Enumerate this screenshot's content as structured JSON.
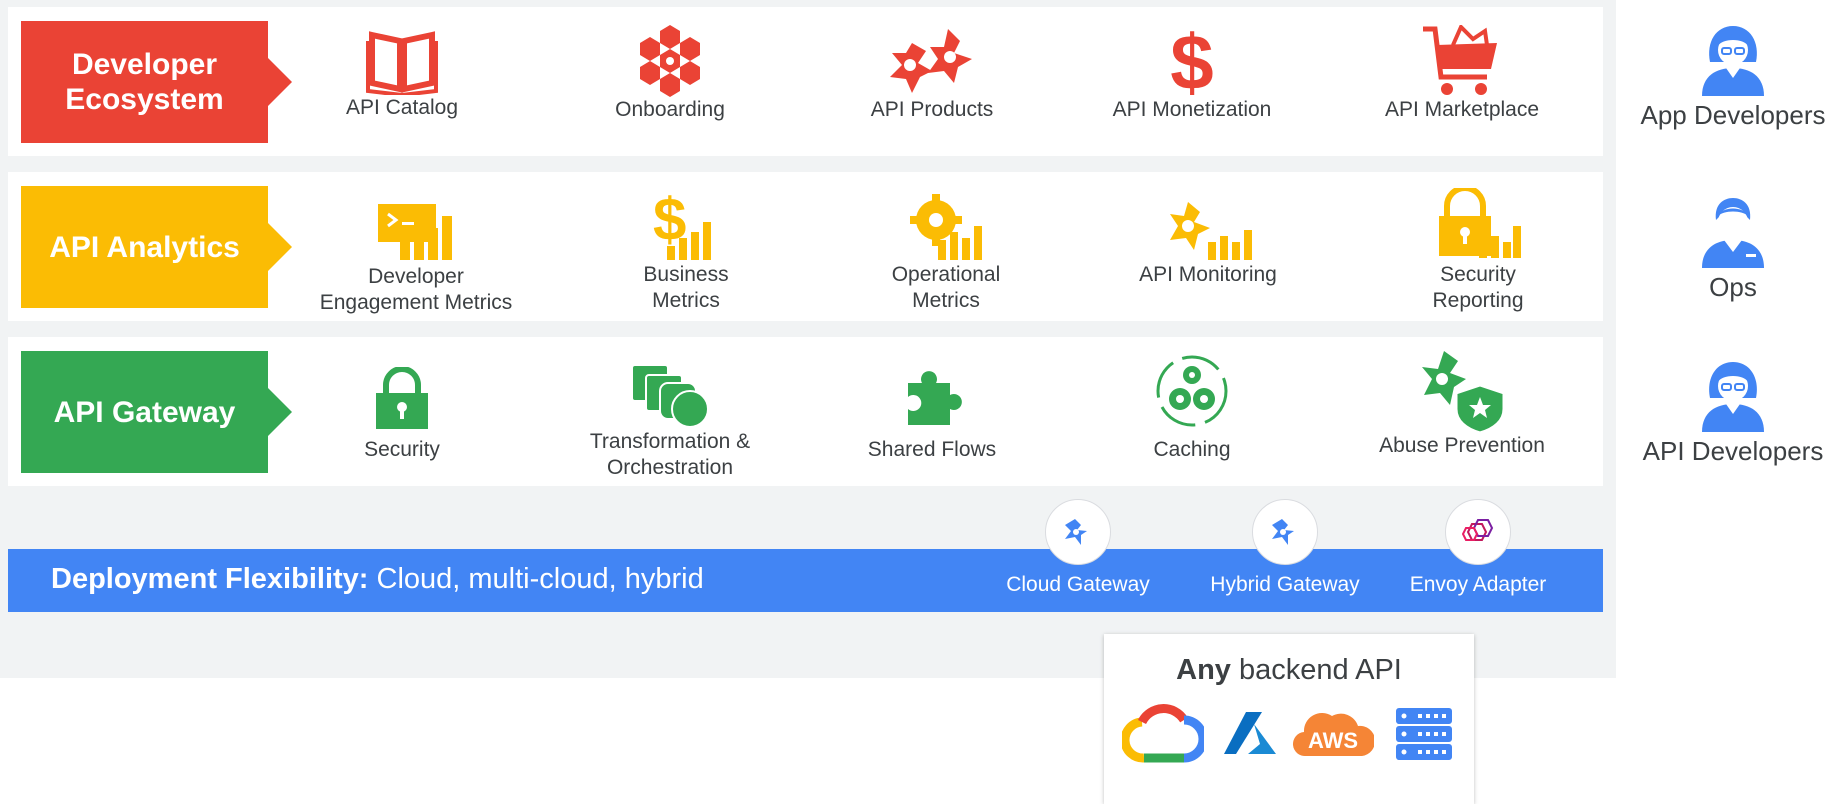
{
  "layers": {
    "developer": {
      "title": "Developer Ecosystem",
      "items": [
        "API Catalog",
        "Onboarding",
        "API Products",
        "API Monetization",
        "API Marketplace"
      ]
    },
    "analytics": {
      "title": "API Analytics",
      "items": [
        "Developer Engagement Metrics",
        "Business Metrics",
        "Operational Metrics",
        "API Monitoring",
        "Security Reporting"
      ]
    },
    "gateway": {
      "title": "API Gateway",
      "items": [
        "Security",
        "Transformation & Orchestration",
        "Shared Flows",
        "Caching",
        "Abuse Prevention"
      ]
    }
  },
  "deployment": {
    "title": "Deployment Flexibility:",
    "detail": "Cloud, multi-cloud, hybrid",
    "gateways": [
      "Cloud Gateway",
      "Hybrid Gateway",
      "Envoy Adapter"
    ]
  },
  "backend": {
    "emphasis": "Any",
    "rest": "backend API",
    "logos": [
      "google-cloud-logo",
      "azure-logo",
      "aws-logo",
      "server-rack-icon"
    ],
    "aws_text": "AWS"
  },
  "personas": [
    "App Developers",
    "Ops",
    "API Developers"
  ],
  "colors": {
    "developer": "#ea4335",
    "analytics": "#fbbc04",
    "gateway": "#34a853",
    "deployment": "#4285f4"
  }
}
